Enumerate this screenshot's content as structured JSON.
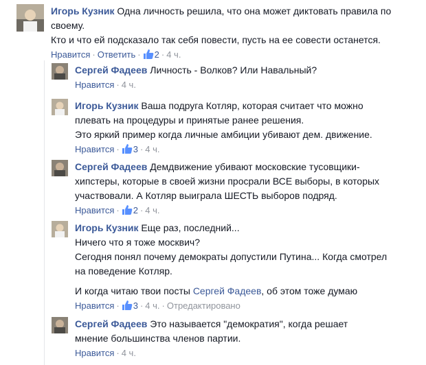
{
  "comments": [
    {
      "author": "Игорь Кузник",
      "text_lines": [
        "Одна личность решила, что она может диктовать правила по своему.",
        "Кто и что ей подсказало так себя повести, пусть на ее совести останется."
      ],
      "like_label": "Нравится",
      "reply_label": "Ответить",
      "likes": "2",
      "time": "4 ч."
    },
    {
      "author": "Сергей Фадеев",
      "text": "Личность - Волков? Или Навальный?",
      "like_label": "Нравится",
      "time": "4 ч."
    },
    {
      "author": "Игорь Кузник",
      "text_lines": [
        "Ваша подруга Котляр, которая считает что можно плевать на процедуры и принятые ранее решения.",
        "Это яркий пример когда личные амбиции убивают дем. движение."
      ],
      "like_label": "Нравится",
      "likes": "3",
      "time": "4 ч."
    },
    {
      "author": "Сергей Фадеев",
      "text": "Демдвижение убивают московские тусовщики-хипстеры, которые в своей жизни просрали ВСЕ выборы, в которых участвовали. А Котляр выиграла ШЕСТЬ выборов подряд.",
      "like_label": "Нравится",
      "likes": "2",
      "time": "4 ч."
    },
    {
      "author": "Игорь Кузник",
      "text_lines": [
        "Еще раз, последний...",
        "Ничего что я тоже москвич?",
        "Сегодня понял почему демократы допустили Путина... Когда смотрел на поведение Котляр."
      ],
      "text_tail_before": "И когда читаю твои посты",
      "text_tail_link": "Сергей Фадеев",
      "text_tail_after": ", об этом тоже думаю",
      "like_label": "Нравится",
      "likes": "3",
      "time": "4 ч.",
      "edited": "Отредактировано"
    },
    {
      "author": "Сергей Фадеев",
      "text": "Это называется \"демократия\", когда решает мнение большинства членов партии.",
      "like_label": "Нравится",
      "time": "4 ч."
    }
  ]
}
